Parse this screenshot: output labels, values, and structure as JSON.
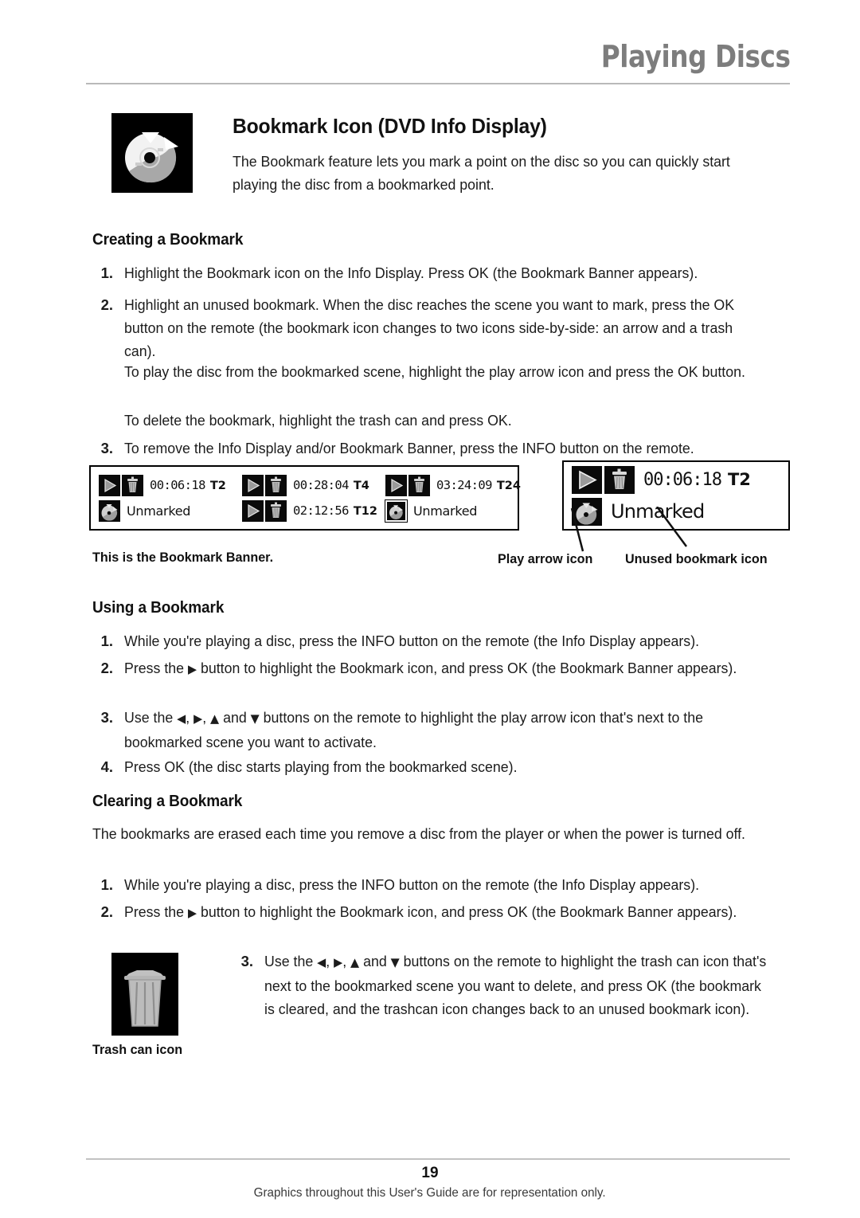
{
  "header": {
    "title": "Playing Discs"
  },
  "intro": {
    "icon_name": "bookmark-disc-icon",
    "title": "Bookmark Icon (DVD Info Display)",
    "body": "The Bookmark feature lets you mark a point on the disc so you can quickly start playing the disc from a bookmarked point."
  },
  "creating": {
    "heading": "Creating a Bookmark",
    "steps": [
      {
        "num": "1.",
        "text": "Highlight the Bookmark icon on the Info Display. Press OK (the Bookmark Banner appears)."
      },
      {
        "num": "2.",
        "text": "Highlight an unused bookmark. When the disc reaches the scene you want to mark, press the OK button on the remote (the bookmark icon changes to two icons side-by-side: an arrow and a trash can)."
      }
    ],
    "note_play": "To play the disc from the bookmarked scene, highlight the play arrow icon and press the OK button.",
    "note_delete": "To delete the bookmark, highlight the trash can and press OK.",
    "step3": {
      "num": "3.",
      "text": "To remove the Info Display and/or Bookmark Banner, press the INFO button on the remote."
    }
  },
  "banner": {
    "entries": [
      {
        "icons": [
          "play-arrow-icon",
          "trash-can-icon"
        ],
        "time": "00:06:18",
        "track": "T2",
        "selected": false
      },
      {
        "icons": [
          "play-arrow-icon",
          "trash-can-icon"
        ],
        "time": "00:28:04",
        "track": "T4",
        "selected": false
      },
      {
        "icons": [
          "play-arrow-icon",
          "trash-can-icon"
        ],
        "time": "03:24:09",
        "track": "T24",
        "selected": false
      },
      {
        "icons": [
          "unused-bookmark-icon"
        ],
        "time": "Unmarked",
        "track": "",
        "selected": false
      },
      {
        "icons": [
          "play-arrow-icon",
          "trash-can-icon"
        ],
        "time": "02:12:56",
        "track": "T12",
        "selected": false
      },
      {
        "icons": [
          "unused-bookmark-icon"
        ],
        "time": "Unmarked",
        "track": "",
        "selected": true
      }
    ],
    "caption": "This is the Bookmark Banner."
  },
  "detail": {
    "row1": {
      "icons": [
        "play-arrow-icon",
        "trash-can-icon"
      ],
      "time": "00:06:18",
      "track": "T2"
    },
    "row2": {
      "icons": [
        "unused-bookmark-icon"
      ],
      "time": "Unmarked"
    },
    "callout_play": "Play arrow icon",
    "callout_unused": "Unused bookmark icon"
  },
  "using": {
    "heading": "Using a Bookmark",
    "steps": [
      {
        "num": "1.",
        "pre": "While you're playing a disc, press the INFO button on the remote (the Info Display appears).",
        "post": ""
      },
      {
        "num": "2.",
        "pre": "Press the ",
        "arrows": "▶",
        "post": " button to highlight the Bookmark icon, and press OK (the Bookmark Banner appears)."
      },
      {
        "num": "3.",
        "pre": "Use the ",
        "a1": "◀",
        "a2": "▶",
        "a3": "▲",
        "a4": "▼",
        "mid": " and ",
        "post": " buttons on the remote to highlight the play arrow icon that's next to the bookmarked scene you want to activate."
      },
      {
        "num": "4.",
        "pre": "Press OK (the disc starts playing from the bookmarked scene).",
        "post": ""
      }
    ]
  },
  "clearing": {
    "heading": "Clearing a Bookmark",
    "intro": "The bookmarks are erased each time you remove a disc from the player or when the power is turned off.",
    "steps": [
      {
        "num": "1.",
        "pre": "While you're playing a disc, press the INFO button on the remote (the Info Display appears).",
        "post": ""
      },
      {
        "num": "2.",
        "pre": "Press the ",
        "arrows": "▶",
        "post": " button to highlight the Bookmark icon, and press OK (the Bookmark Banner appears)."
      },
      {
        "num": "3.",
        "pre": "Use the ",
        "a1": "◀",
        "a2": "▶",
        "a3": "▲",
        "a4": "▼",
        "mid": " and ",
        "post": " buttons on the remote to highlight the trash can icon that's next to the bookmarked scene you want to delete, and press OK (the bookmark is cleared, and the trashcan icon changes back to an unused bookmark icon)."
      }
    ]
  },
  "trash_figure": {
    "icon_name": "trash-can-icon",
    "caption": "Trash can icon"
  },
  "footer": {
    "page_number": "19",
    "note": "Graphics throughout this User's Guide are for representation only."
  }
}
